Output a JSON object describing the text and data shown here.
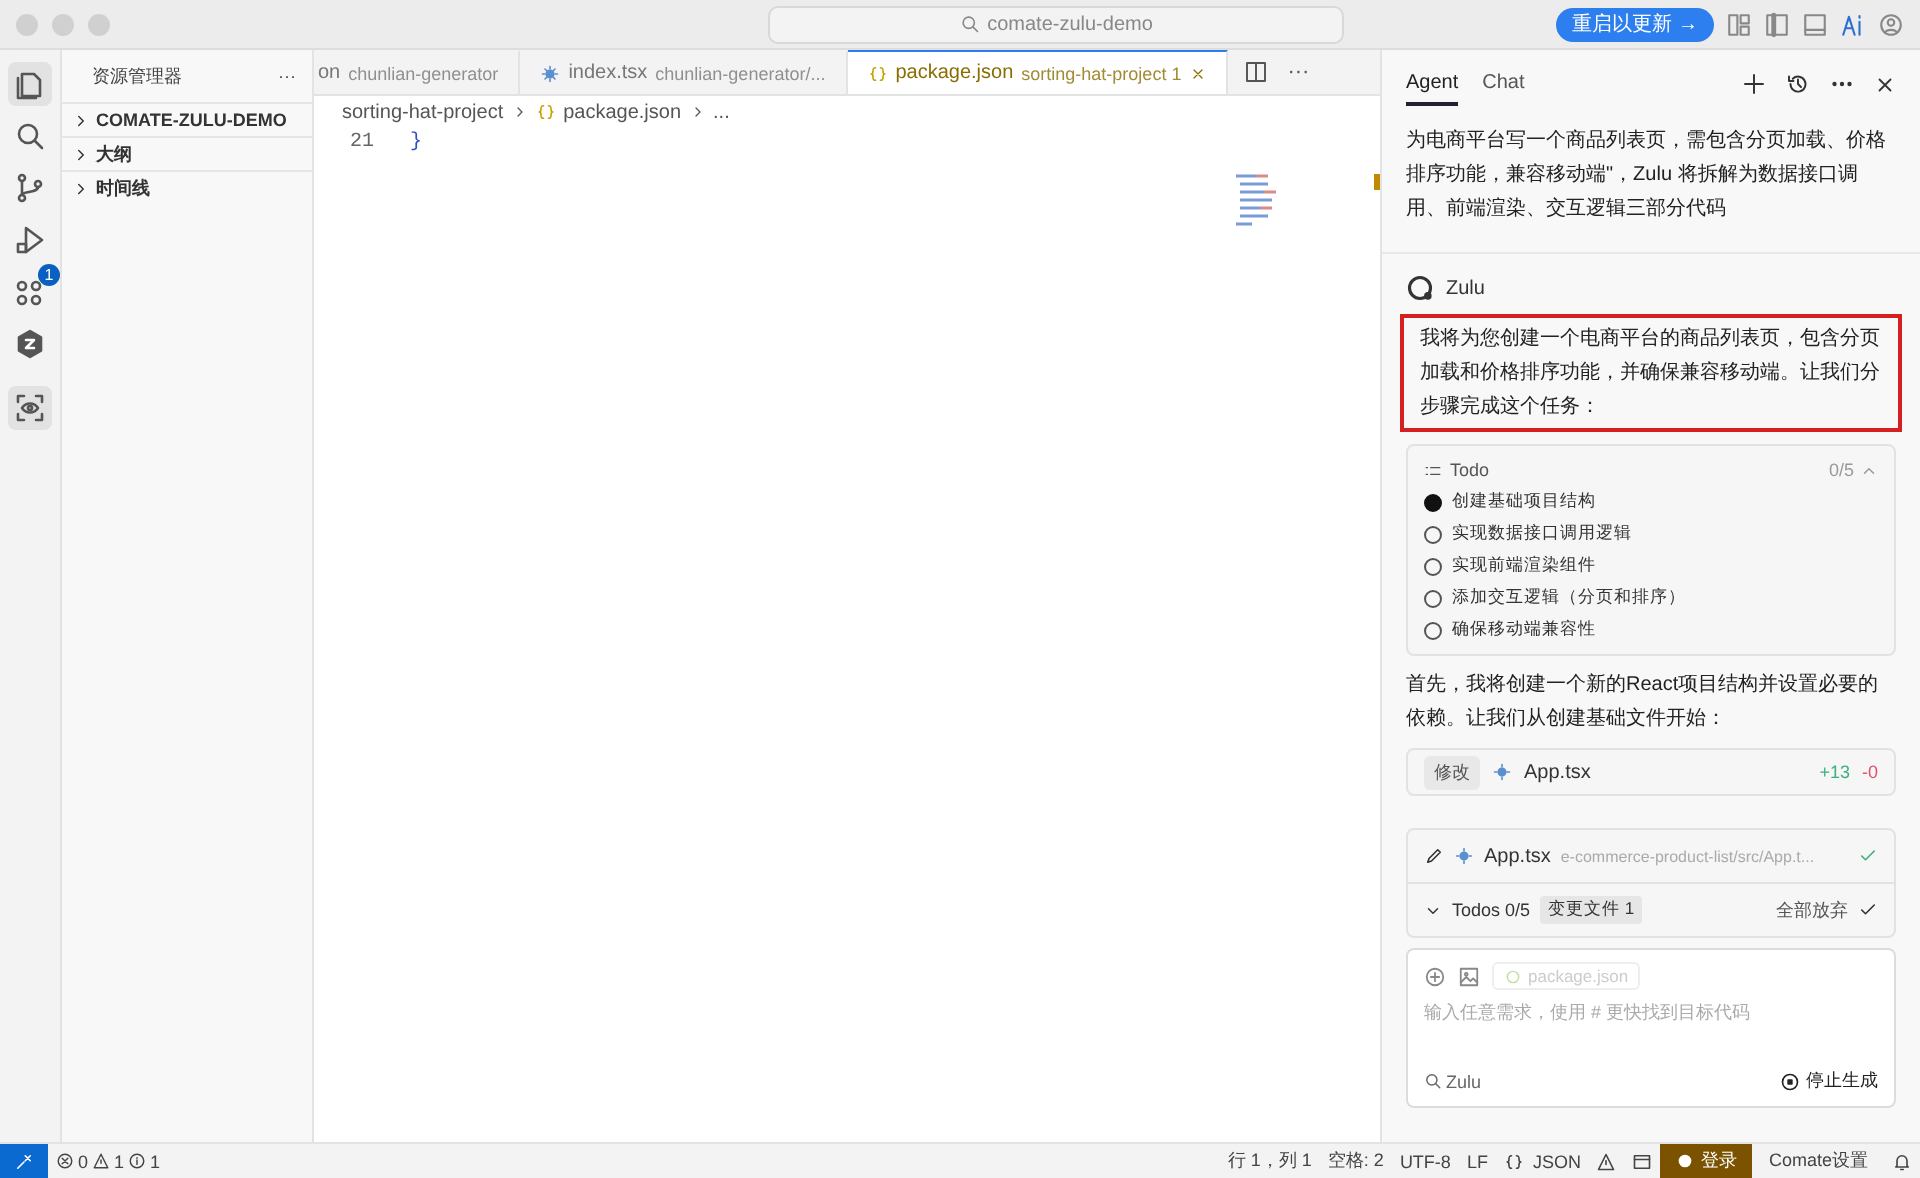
{
  "title_bar": {
    "search": "comate-zulu-demo",
    "update_button": "重启以更新 →"
  },
  "activity_bar": {
    "items": [
      {
        "selected": true
      },
      {
        "selected": false
      },
      {
        "selected": false
      },
      {
        "selected": false
      },
      {
        "selected": false,
        "badge": "1"
      },
      {
        "selected": false
      },
      {
        "selected": true
      }
    ]
  },
  "sidebar": {
    "title": "资源管理器",
    "more": "···",
    "sections": [
      {
        "label": "COMATE-ZULU-DEMO",
        "expanded": false
      },
      {
        "label": "大纲",
        "expanded": false
      },
      {
        "label": "时间线",
        "expanded": false
      }
    ]
  },
  "editor": {
    "tabs": [
      {
        "name": "on",
        "path": "chunlian-generator",
        "kind": "plain",
        "selected": false
      },
      {
        "name": "index.tsx",
        "path": "chunlian-generator/...",
        "kind": "tsx",
        "selected": false
      },
      {
        "name": "package.json",
        "path": "sorting-hat-project 1",
        "kind": "json",
        "selected": true
      }
    ],
    "more": "···",
    "breadcrumb": [
      "sorting-hat-project",
      "package.json",
      "..."
    ],
    "lines": [
      {
        "number": "21",
        "code": "}"
      }
    ]
  },
  "panel": {
    "tabs": [
      {
        "label": "Agent",
        "selected": true
      },
      {
        "label": "Chat",
        "selected": false
      }
    ],
    "user_message": "为电商平台写一个商品列表页，需包含分页加载、价格排序功能，兼容移动端\"，Zulu 将拆解为数据接口调用、前端渲染、交互逻辑三部分代码",
    "assistant": "Zulu",
    "reply": "我将为您创建一个电商平台的商品列表页，包含分页加载和价格排序功能，并确保兼容移动端。让我们分步骤完成这个任务：",
    "todo": {
      "title": "Todo",
      "count": "0/5",
      "expanded": true,
      "items": [
        {
          "label": "创建基础项目结构",
          "current": true
        },
        {
          "label": "实现数据接口调用逻辑",
          "current": false
        },
        {
          "label": "实现前端渲染组件",
          "current": false
        },
        {
          "label": "添加交互逻辑（分页和排序）",
          "current": false
        },
        {
          "label": "确保移动端兼容性",
          "current": false
        }
      ]
    },
    "followup": "首先，我将创建一个新的React项目结构并设置必要的依赖。让我们从创建基础文件开始：",
    "change": {
      "tag": "修改",
      "file": "App.tsx",
      "added": "+13",
      "removed": "-0"
    },
    "file_card": {
      "file": "App.tsx",
      "path": "e-commerce-product-list/src/App.t...",
      "todos": "Todos 0/5",
      "changed": "变更文件 1",
      "discard": "全部放弃"
    },
    "input": {
      "context": "package.json",
      "placeholder": "输入任意需求，使用 # 更快找到目标代码",
      "mode": "Zulu",
      "stop": "停止生成"
    }
  },
  "status_bar": {
    "errors": "0",
    "warnings": "1",
    "infos": "1",
    "position": "行 1，列 1",
    "spaces": "空格: 2",
    "encoding": "UTF-8",
    "eol": "LF",
    "language": "JSON",
    "login": "登录",
    "settings": "Comate设置"
  }
}
